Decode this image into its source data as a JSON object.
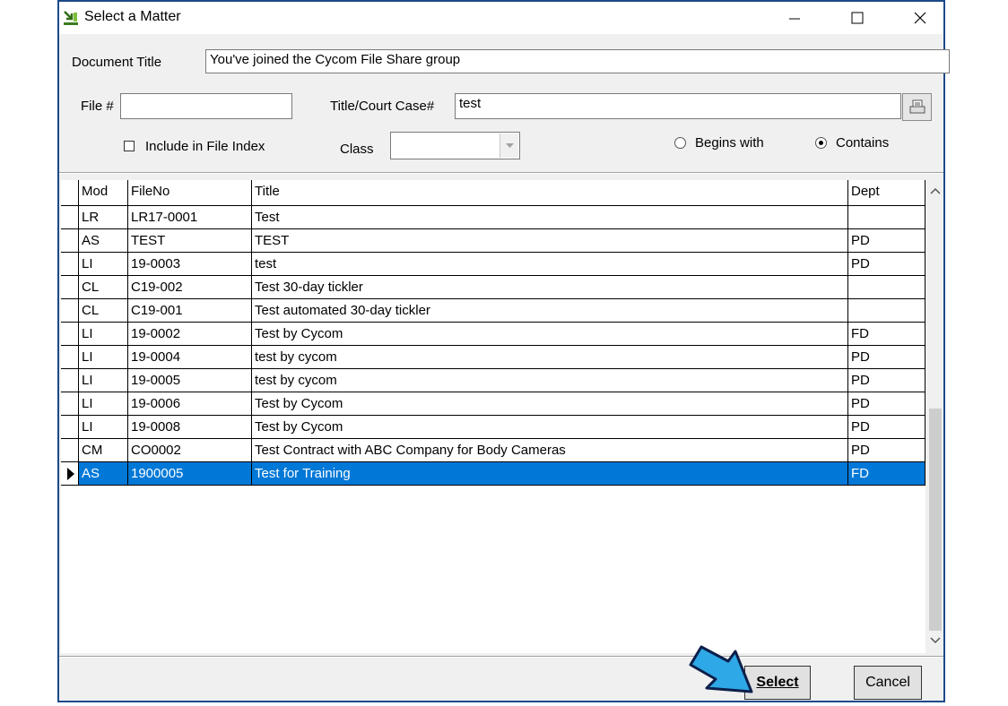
{
  "window": {
    "title": "Select a Matter"
  },
  "form": {
    "document_title_label": "Document Title",
    "document_title_value": "You've joined the Cycom File Share group",
    "file_label": "File #",
    "file_value": "",
    "title_case_label": "Title/Court Case#",
    "title_case_value": "test",
    "include_index_label": "Include in File Index",
    "include_index_checked": false,
    "class_label": "Class",
    "class_value": "",
    "begins_with_label": "Begins with",
    "contains_label": "Contains",
    "match_mode": "Contains"
  },
  "table": {
    "columns": [
      "Mod",
      "FileNo",
      "Title",
      "Dept"
    ],
    "rows": [
      {
        "mod": "LR",
        "fileno": "LR17-0001",
        "title": "Test",
        "dept": ""
      },
      {
        "mod": "AS",
        "fileno": "TEST",
        "title": "TEST",
        "dept": "PD"
      },
      {
        "mod": "LI",
        "fileno": "19-0003",
        "title": "test",
        "dept": "PD"
      },
      {
        "mod": "CL",
        "fileno": "C19-002",
        "title": "Test 30-day tickler",
        "dept": ""
      },
      {
        "mod": "CL",
        "fileno": "C19-001",
        "title": "Test automated 30-day tickler",
        "dept": ""
      },
      {
        "mod": "LI",
        "fileno": "19-0002",
        "title": "Test by Cycom",
        "dept": "FD"
      },
      {
        "mod": "LI",
        "fileno": "19-0004",
        "title": "test by cycom",
        "dept": "PD"
      },
      {
        "mod": "LI",
        "fileno": "19-0005",
        "title": "test by cycom",
        "dept": "PD"
      },
      {
        "mod": "LI",
        "fileno": "19-0006",
        "title": "Test by Cycom",
        "dept": "PD"
      },
      {
        "mod": "LI",
        "fileno": "19-0008",
        "title": "Test by Cycom",
        "dept": "PD"
      },
      {
        "mod": "CM",
        "fileno": "CO0002",
        "title": "Test Contract with ABC Company for Body Cameras",
        "dept": "PD"
      },
      {
        "mod": "AS",
        "fileno": "1900005",
        "title": "Test for Training",
        "dept": "FD",
        "selected": true
      }
    ]
  },
  "buttons": {
    "select_label": "Select",
    "cancel_label": "Cancel"
  },
  "colors": {
    "selection": "#0078d7",
    "window_border": "#1c4a8a",
    "arrow": "#2ea8e6"
  }
}
